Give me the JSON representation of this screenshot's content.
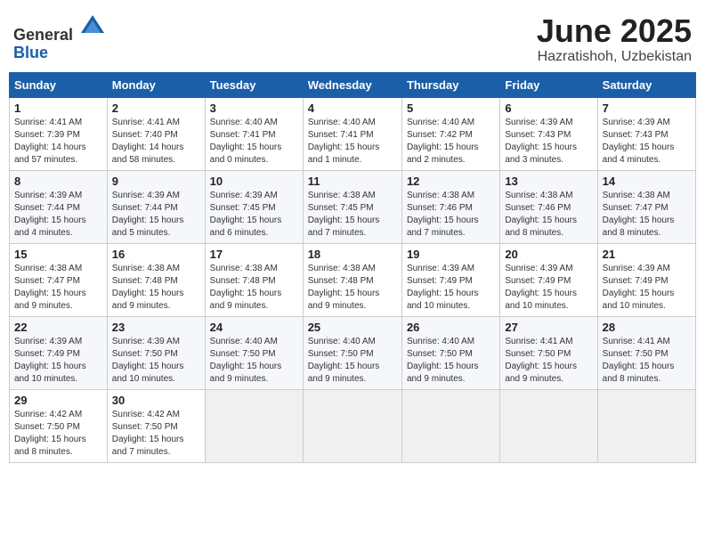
{
  "header": {
    "logo_general": "General",
    "logo_blue": "Blue",
    "month": "June 2025",
    "location": "Hazratishoh, Uzbekistan"
  },
  "days_of_week": [
    "Sunday",
    "Monday",
    "Tuesday",
    "Wednesday",
    "Thursday",
    "Friday",
    "Saturday"
  ],
  "weeks": [
    [
      {
        "day": "1",
        "info": "Sunrise: 4:41 AM\nSunset: 7:39 PM\nDaylight: 14 hours\nand 57 minutes."
      },
      {
        "day": "2",
        "info": "Sunrise: 4:41 AM\nSunset: 7:40 PM\nDaylight: 14 hours\nand 58 minutes."
      },
      {
        "day": "3",
        "info": "Sunrise: 4:40 AM\nSunset: 7:41 PM\nDaylight: 15 hours\nand 0 minutes."
      },
      {
        "day": "4",
        "info": "Sunrise: 4:40 AM\nSunset: 7:41 PM\nDaylight: 15 hours\nand 1 minute."
      },
      {
        "day": "5",
        "info": "Sunrise: 4:40 AM\nSunset: 7:42 PM\nDaylight: 15 hours\nand 2 minutes."
      },
      {
        "day": "6",
        "info": "Sunrise: 4:39 AM\nSunset: 7:43 PM\nDaylight: 15 hours\nand 3 minutes."
      },
      {
        "day": "7",
        "info": "Sunrise: 4:39 AM\nSunset: 7:43 PM\nDaylight: 15 hours\nand 4 minutes."
      }
    ],
    [
      {
        "day": "8",
        "info": "Sunrise: 4:39 AM\nSunset: 7:44 PM\nDaylight: 15 hours\nand 4 minutes."
      },
      {
        "day": "9",
        "info": "Sunrise: 4:39 AM\nSunset: 7:44 PM\nDaylight: 15 hours\nand 5 minutes."
      },
      {
        "day": "10",
        "info": "Sunrise: 4:39 AM\nSunset: 7:45 PM\nDaylight: 15 hours\nand 6 minutes."
      },
      {
        "day": "11",
        "info": "Sunrise: 4:38 AM\nSunset: 7:45 PM\nDaylight: 15 hours\nand 7 minutes."
      },
      {
        "day": "12",
        "info": "Sunrise: 4:38 AM\nSunset: 7:46 PM\nDaylight: 15 hours\nand 7 minutes."
      },
      {
        "day": "13",
        "info": "Sunrise: 4:38 AM\nSunset: 7:46 PM\nDaylight: 15 hours\nand 8 minutes."
      },
      {
        "day": "14",
        "info": "Sunrise: 4:38 AM\nSunset: 7:47 PM\nDaylight: 15 hours\nand 8 minutes."
      }
    ],
    [
      {
        "day": "15",
        "info": "Sunrise: 4:38 AM\nSunset: 7:47 PM\nDaylight: 15 hours\nand 9 minutes."
      },
      {
        "day": "16",
        "info": "Sunrise: 4:38 AM\nSunset: 7:48 PM\nDaylight: 15 hours\nand 9 minutes."
      },
      {
        "day": "17",
        "info": "Sunrise: 4:38 AM\nSunset: 7:48 PM\nDaylight: 15 hours\nand 9 minutes."
      },
      {
        "day": "18",
        "info": "Sunrise: 4:38 AM\nSunset: 7:48 PM\nDaylight: 15 hours\nand 9 minutes."
      },
      {
        "day": "19",
        "info": "Sunrise: 4:39 AM\nSunset: 7:49 PM\nDaylight: 15 hours\nand 10 minutes."
      },
      {
        "day": "20",
        "info": "Sunrise: 4:39 AM\nSunset: 7:49 PM\nDaylight: 15 hours\nand 10 minutes."
      },
      {
        "day": "21",
        "info": "Sunrise: 4:39 AM\nSunset: 7:49 PM\nDaylight: 15 hours\nand 10 minutes."
      }
    ],
    [
      {
        "day": "22",
        "info": "Sunrise: 4:39 AM\nSunset: 7:49 PM\nDaylight: 15 hours\nand 10 minutes."
      },
      {
        "day": "23",
        "info": "Sunrise: 4:39 AM\nSunset: 7:50 PM\nDaylight: 15 hours\nand 10 minutes."
      },
      {
        "day": "24",
        "info": "Sunrise: 4:40 AM\nSunset: 7:50 PM\nDaylight: 15 hours\nand 9 minutes."
      },
      {
        "day": "25",
        "info": "Sunrise: 4:40 AM\nSunset: 7:50 PM\nDaylight: 15 hours\nand 9 minutes."
      },
      {
        "day": "26",
        "info": "Sunrise: 4:40 AM\nSunset: 7:50 PM\nDaylight: 15 hours\nand 9 minutes."
      },
      {
        "day": "27",
        "info": "Sunrise: 4:41 AM\nSunset: 7:50 PM\nDaylight: 15 hours\nand 9 minutes."
      },
      {
        "day": "28",
        "info": "Sunrise: 4:41 AM\nSunset: 7:50 PM\nDaylight: 15 hours\nand 8 minutes."
      }
    ],
    [
      {
        "day": "29",
        "info": "Sunrise: 4:42 AM\nSunset: 7:50 PM\nDaylight: 15 hours\nand 8 minutes."
      },
      {
        "day": "30",
        "info": "Sunrise: 4:42 AM\nSunset: 7:50 PM\nDaylight: 15 hours\nand 7 minutes."
      },
      {
        "day": "",
        "info": ""
      },
      {
        "day": "",
        "info": ""
      },
      {
        "day": "",
        "info": ""
      },
      {
        "day": "",
        "info": ""
      },
      {
        "day": "",
        "info": ""
      }
    ]
  ]
}
